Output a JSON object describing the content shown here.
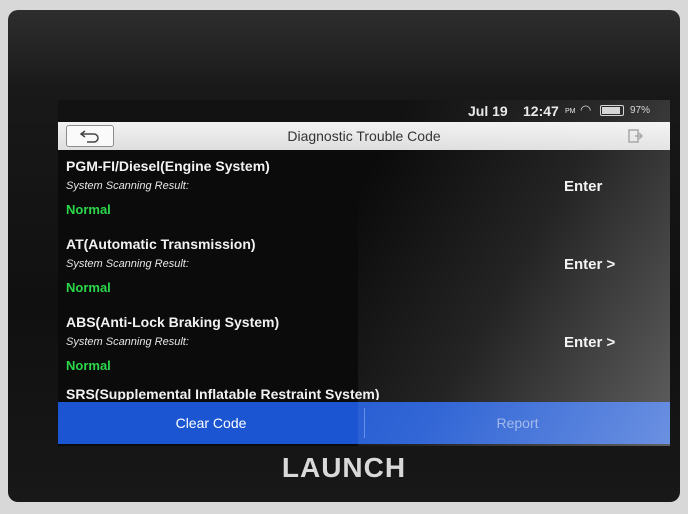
{
  "status_bar": {
    "date": "Jul 19",
    "time": "12:47",
    "ampm": "PM",
    "battery_percent": "97%",
    "battery_level": 0.97,
    "icons": [
      "wifi-icon",
      "battery-icon"
    ]
  },
  "header": {
    "title": "Diagnostic Trouble Code",
    "icons": [
      "back-arrow-icon",
      "exit-icon"
    ]
  },
  "systems": [
    {
      "name": "PGM-FI/Diesel(Engine System)",
      "label": "System Scanning Result:",
      "status": "Normal",
      "action": "Enter"
    },
    {
      "name": "AT(Automatic Transmission)",
      "label": "System Scanning Result:",
      "status": "Normal",
      "action": "Enter >"
    },
    {
      "name": "ABS(Anti-Lock Braking System)",
      "label": "System Scanning Result:",
      "status": "Normal",
      "action": "Enter >"
    },
    {
      "name": "SRS(Supplemental Inflatable Restraint System)"
    }
  ],
  "footer": {
    "clear_label": "Clear Code",
    "report_label": "Report"
  },
  "brand": "LAUNCH",
  "colors": {
    "status_ok": "#2bd84a",
    "footer_bg": "#1b55d1",
    "header_bg": "#e8e8e8"
  }
}
